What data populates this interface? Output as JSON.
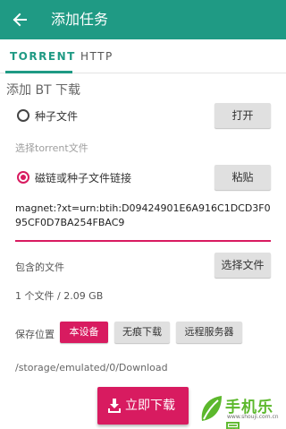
{
  "app_bar": {
    "title": "添加任务",
    "color": "#1f9a84"
  },
  "tabs": [
    {
      "label": "TORRENT",
      "selected": true
    },
    {
      "label": "HTTP",
      "selected": false
    }
  ],
  "section_title": "添加 BT 下载",
  "source": {
    "torrent_file": {
      "label": "种子文件",
      "selected": false,
      "button": "打开"
    },
    "torrent_hint": "选择torrent文件",
    "magnet": {
      "label": "磁链或种子文件链接",
      "selected": true,
      "button": "粘贴"
    },
    "magnet_value": "magnet:?xt=urn:btih:D09424901E6A916C1DCD3F095CF0D7BA254FBAC9"
  },
  "files": {
    "label": "包含的文件",
    "button": "选择文件",
    "summary": "1 个文件 / 2.09 GB"
  },
  "save_location": {
    "label": "保存位置",
    "options": [
      "本设备",
      "无痕下载",
      "远程服务器"
    ],
    "selected": "本设备",
    "path": "/storage/emulated/0/Download"
  },
  "download_button": {
    "label": "立即下载",
    "color": "#d81b60"
  },
  "watermark": {
    "text": "手机乐园",
    "url": "www.shouji.com.cn"
  }
}
